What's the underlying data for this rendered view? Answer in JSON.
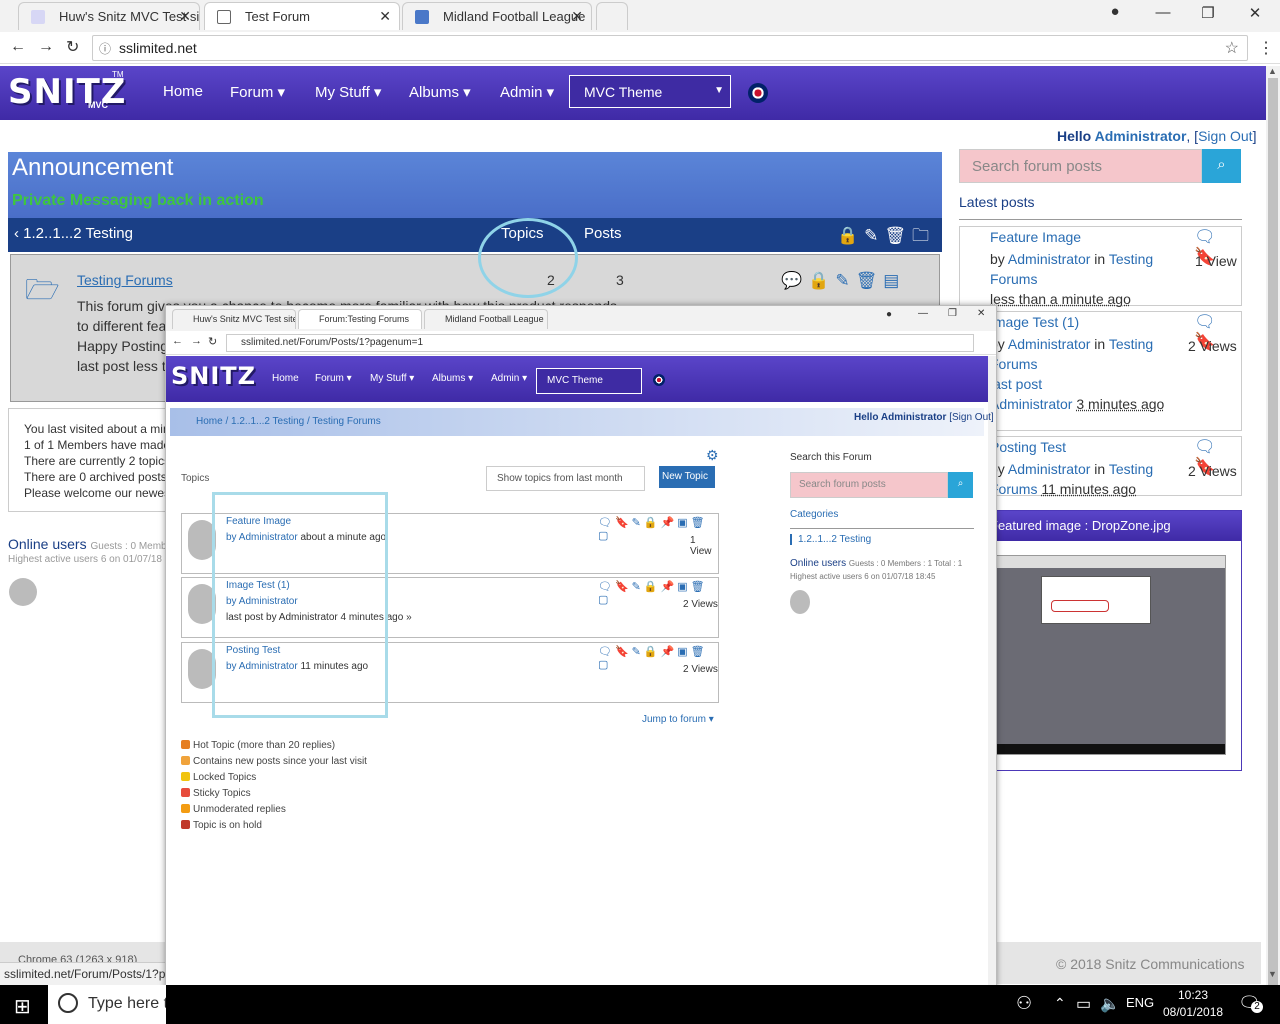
{
  "browser": {
    "tabs": [
      {
        "title": "Huw's Snitz MVC Test site"
      },
      {
        "title": "Test Forum"
      },
      {
        "title": "Midland Football League"
      }
    ],
    "url": "sslimited.net"
  },
  "site": {
    "logo": "SNITZ",
    "logo_sub": "MVC",
    "logo_tm": "TM",
    "nav": [
      "Home",
      "Forum ▾",
      "My Stuff ▾",
      "Albums ▾",
      "Admin ▾"
    ],
    "theme_select": "MVC Theme",
    "hello": "Hello",
    "user": "Administrator",
    "sign_out": "Sign Out"
  },
  "announcement": {
    "title": "Announcement",
    "message": "Private Messaging back in action"
  },
  "category": {
    "name": "1.2..1...2 Testing",
    "col_topics": "Topics",
    "col_posts": "Posts"
  },
  "forum": {
    "name": "Testing Forums",
    "topics": "2",
    "posts": "3",
    "desc_lines": [
      "This forum gives you a chance to become more familiar with how this product responds",
      "to different features and keeps testing in the live forums",
      "Happy Posting!",
      "last post  less than a minute ago"
    ]
  },
  "stats": {
    "lines": [
      "You last visited  about a minute ago",
      "1 of 1 Members have made posts",
      "There are currently 2 topics",
      "There are 0 archived posts",
      "Please welcome our newest member"
    ],
    "online_title": "Online users",
    "online_sub": "Guests : 0 Members : 1 Total : 1",
    "highest": "Highest active users 6 on 01/07/18 18:45"
  },
  "sidebar": {
    "search_placeholder": "Search forum posts",
    "latest_title": "Latest posts",
    "posts": [
      {
        "title": "Feature Image",
        "by": "by",
        "author": "Administrator",
        "in": "in",
        "forum": "Testing Forums",
        "time": "less than a minute ago",
        "views": "1 View"
      },
      {
        "title": "Image Test (1)",
        "by": "by",
        "author": "Administrator",
        "in": "in",
        "forum": "Testing Forums",
        "last": "last post",
        "time": "3 minutes ago",
        "views": "2 Views"
      },
      {
        "title": "Posting Test",
        "by": "by",
        "author": "Administrator",
        "in": "in",
        "forum": "Testing Forums",
        "time": "11 minutes ago",
        "views": "2 Views"
      }
    ],
    "featured_title": "Featured image : DropZone.jpg"
  },
  "footer": {
    "copyright": "© 2018 Snitz Communications",
    "status_url": "sslimited.net/Forum/Posts/1?p",
    "chrome_size": "Chrome 63 (1263 x 918)"
  },
  "inner": {
    "tabs": [
      "Huw's Snitz MVC Test site",
      "Forum:Testing Forums",
      "Midland Football League"
    ],
    "url": "sslimited.net/Forum/Posts/1?pagenum=1",
    "breadcrumb": [
      "Home",
      "1.2..1...2 Testing",
      "Testing Forums"
    ],
    "topics_label": "Topics",
    "filter": "Show topics from last month",
    "new_topic": "New Topic",
    "search_label": "Search this Forum",
    "search_placeholder": "Search forum posts",
    "categories": "Categories",
    "cat_item": "1.2..1...2 Testing",
    "online": "Online users",
    "online_sub": "Guests : 0 Members : 1 Total : 1",
    "highest": "Highest active users 6 on 01/07/18 18:45",
    "topics": [
      {
        "title": "Feature Image",
        "by": "by Administrator",
        "time": "about a minute ago",
        "views": "1 View",
        "last": ""
      },
      {
        "title": "Image Test (1)",
        "by": "by Administrator",
        "time": "",
        "views": "2 Views",
        "last": "last post by Administrator  4 minutes ago »"
      },
      {
        "title": "Posting Test",
        "by": "by Administrator",
        "time": "11 minutes ago",
        "views": "2 Views",
        "last": ""
      }
    ],
    "jump": "Jump to forum ▾",
    "legend": [
      "Hot Topic (more than 20 replies)",
      "Contains new posts since your last visit",
      "Locked Topics",
      "Sticky Topics",
      "Unmoderated replies",
      "Topic is on hold"
    ]
  },
  "taskbar": {
    "search": "Type here to search",
    "lang": "ENG",
    "time": "10:23",
    "date": "08/01/2018",
    "notif": "2"
  }
}
